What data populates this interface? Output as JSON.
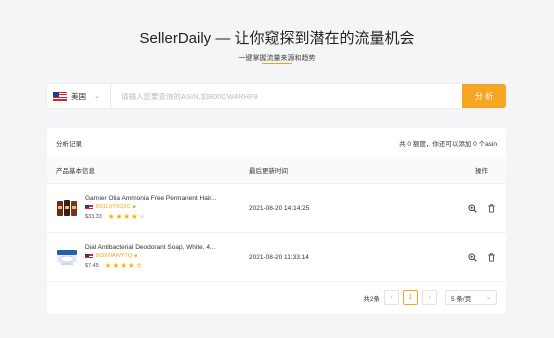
{
  "header": {
    "title": "SellerDaily — 让你窥探到潜在的流量机会",
    "subtitle": "一键掌握流量来源和趋势"
  },
  "search": {
    "country": "美国",
    "placeholder": "请输入您要查询的ASIN,如B00CW4RHF8",
    "value": "",
    "button_label": "分 析"
  },
  "records": {
    "title": "分析记录",
    "quota_text": "共 0 额度，你还可以添加 0 个asin",
    "columns": {
      "info": "产品基本信息",
      "time": "最后更新时间",
      "actions": "操作"
    },
    "rows": [
      {
        "name": "Garnier Olia Ammonia Free Permanent Hair...",
        "asin": "B01LXY2O2C",
        "price": "$33.33",
        "rating": 4,
        "updated": "2021-08-20 14:14:25"
      },
      {
        "name": "Dial Antibacterial Deodorant Soap, White, 4...",
        "asin": "B000VAWYTQ",
        "price": "$7.45",
        "rating": 4.5,
        "updated": "2021-08-20 11:33:14"
      }
    ]
  },
  "pagination": {
    "total_text": "共2条",
    "current_page": "1",
    "page_size": "5 条/页"
  },
  "colors": {
    "accent": "#f5a623",
    "star": "#f5b301",
    "background": "#f4f5f7"
  }
}
